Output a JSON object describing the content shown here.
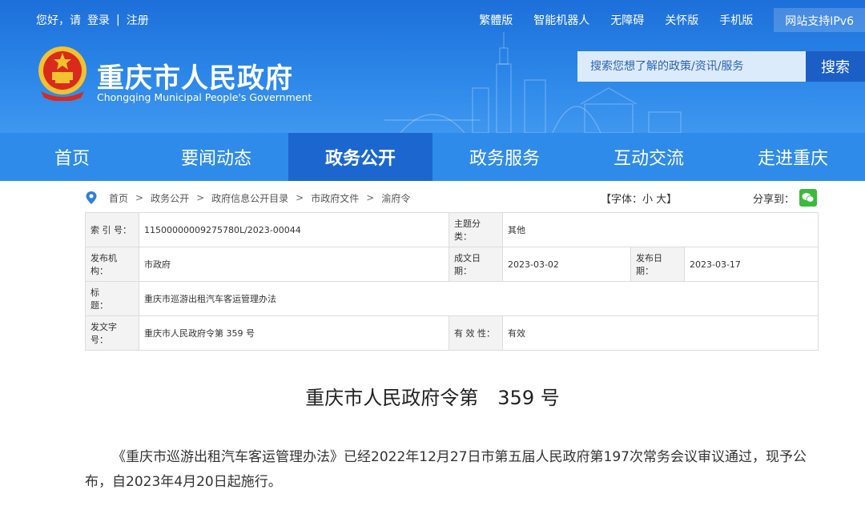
{
  "topbar": {
    "left": [
      "您好，请",
      "登录",
      "|",
      "注册"
    ],
    "right": [
      "繁體版",
      "智能机器人",
      "无障碍",
      "关怀版",
      "手机版"
    ],
    "ipv6": "网站支持IPv6"
  },
  "site": {
    "name": "重庆市人民政府",
    "en": "Chongqing Municipal People's Government"
  },
  "search": {
    "placeholder": "搜索您想了解的政策/资讯/服务",
    "button": "搜索"
  },
  "nav": {
    "items": [
      "首页",
      "要闻动态",
      "政务公开",
      "政务服务",
      "互动交流",
      "走进重庆"
    ],
    "active_index": 2
  },
  "breadcrumb": {
    "items": [
      "首页",
      "政务公开",
      "政府信息公开目录",
      "市政府文件",
      "渝府令"
    ],
    "separator": ">"
  },
  "font_control": "【字体：小 大】",
  "share_label": "分享到：",
  "info": {
    "index_label": "索 引 号：",
    "index_value": "11500000009275780L/2023-00044",
    "topic_label": "主题分类：",
    "topic_value": "其他",
    "issuer_label": "发布机构：",
    "issuer_value": "市政府",
    "written_label": "成文日期：",
    "written_value": "2023-03-02",
    "published_label": "发布日期：",
    "published_value": "2023-03-17",
    "title_label": "标　　题：",
    "title_value": "重庆市巡游出租汽车客运管理办法",
    "docno_label": "发文字号：",
    "docno_value": "重庆市人民政府令第 359 号",
    "validity_label": "有 效 性：",
    "validity_value": "有效"
  },
  "document": {
    "title": "重庆市人民政府令第　359 号",
    "paragraph": "《重庆市巡游出租汽车客运管理办法》已经2022年12月27日市第五届人民政府第197次常务会议审议通过，现予公布，自2023年4月20日起施行。"
  },
  "colors": {
    "header_blue": "#2b86e8",
    "nav_blue": "#2f8be9",
    "nav_active": "#1b67cf",
    "search_btn": "#1b5fc6",
    "wechat_green": "#3dba3d"
  }
}
